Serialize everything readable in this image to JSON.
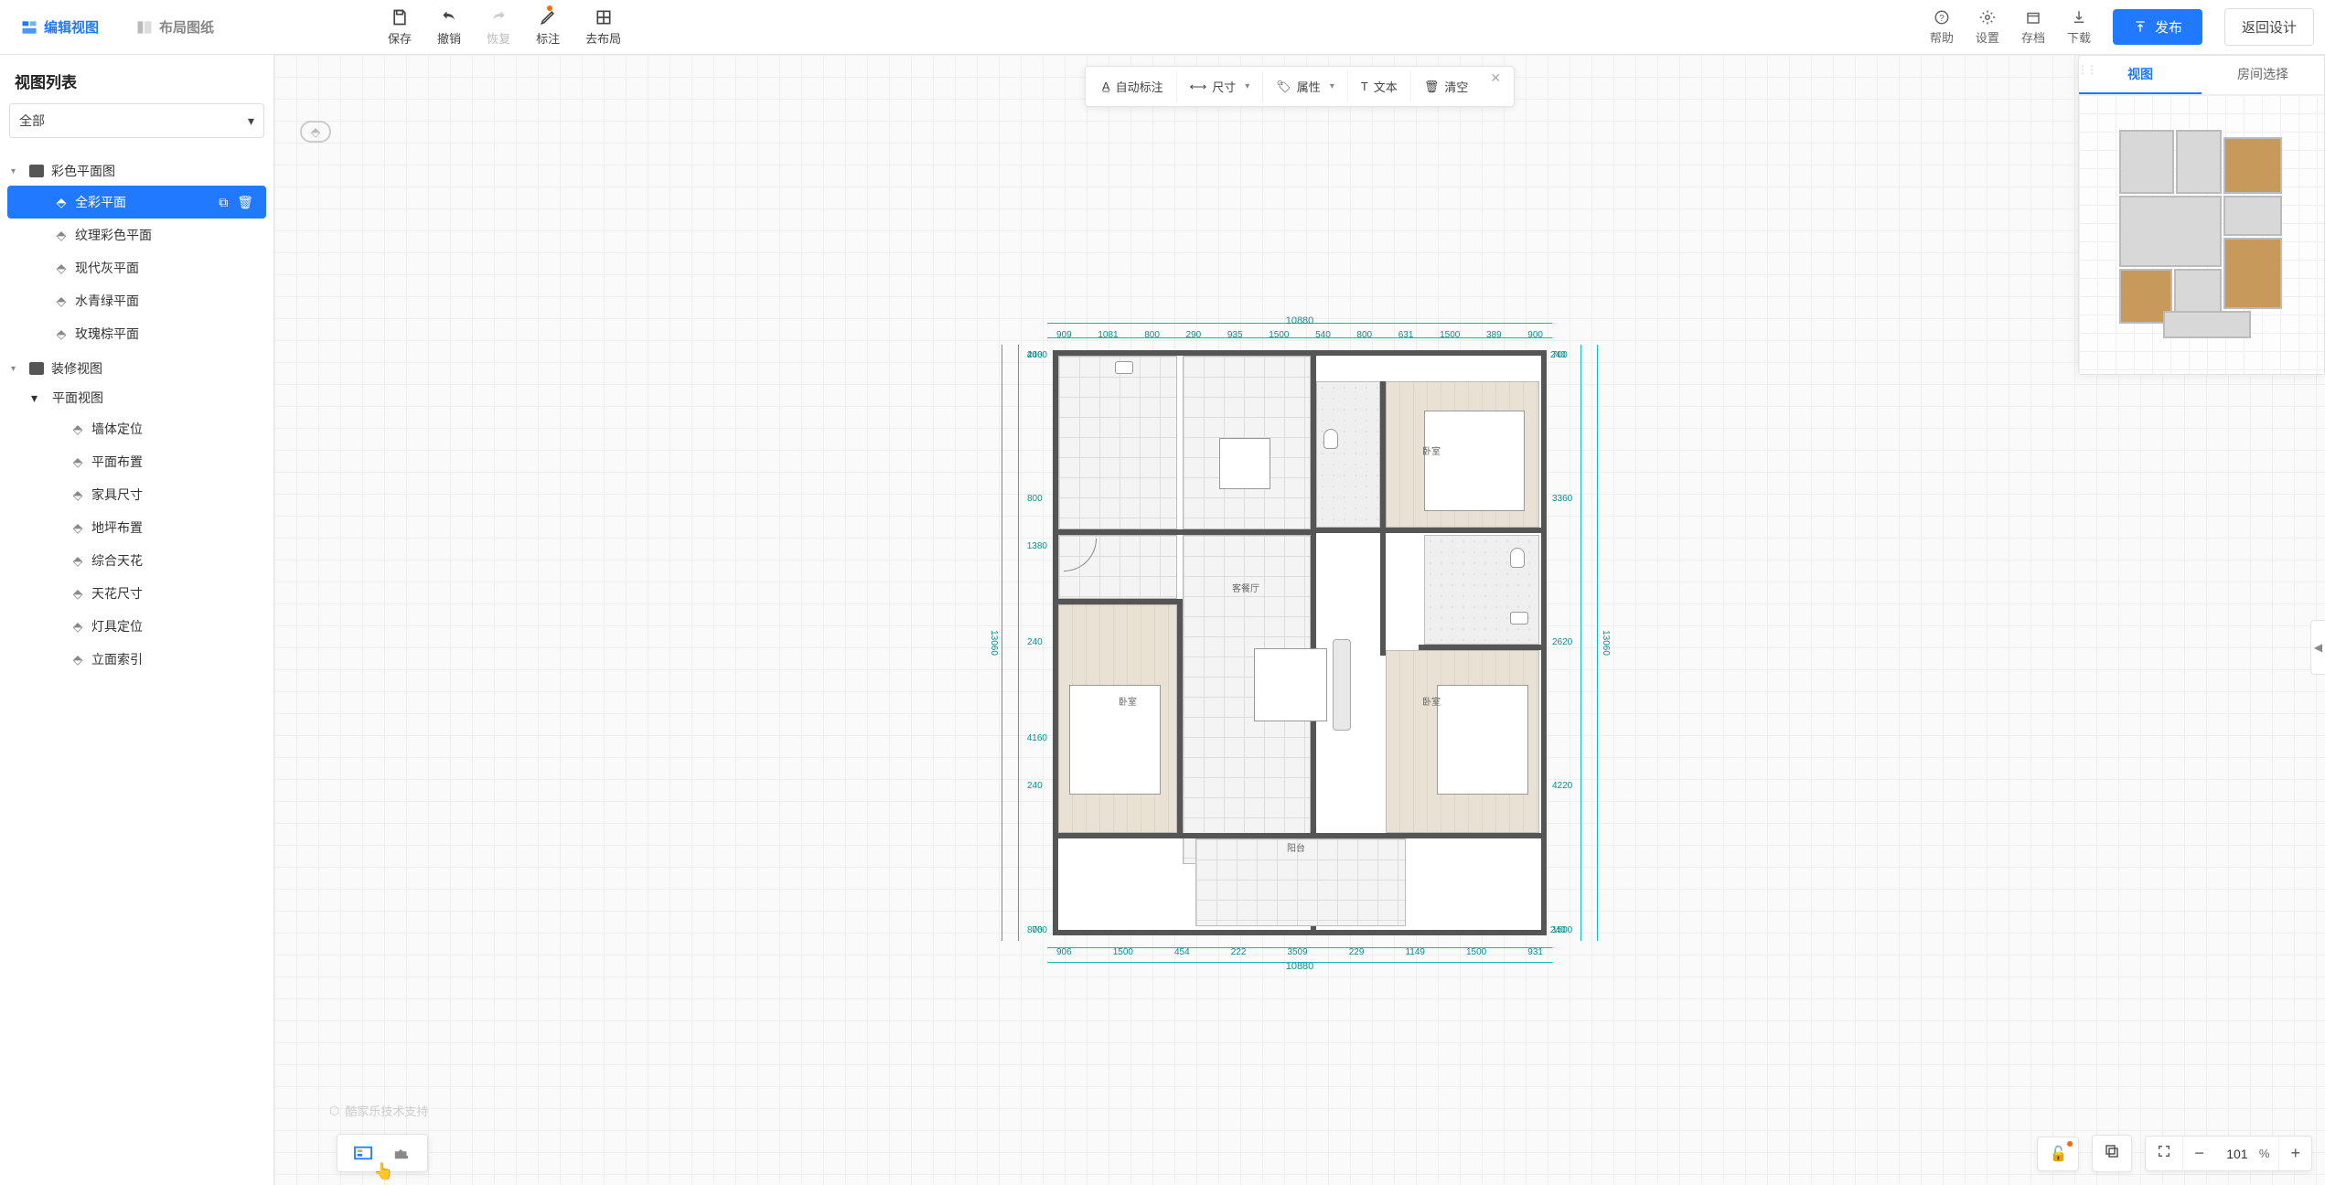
{
  "header": {
    "left_tabs": [
      {
        "label": "编辑视图",
        "active": true
      },
      {
        "label": "布局图纸",
        "active": false
      }
    ],
    "center": {
      "save": "保存",
      "undo": "撤销",
      "redo": "恢复",
      "annotate": "标注",
      "layout": "去布局"
    },
    "right": {
      "help": "帮助",
      "settings": "设置",
      "archive": "存档",
      "download": "下载",
      "publish": "发布",
      "back": "返回设计"
    }
  },
  "sidebar": {
    "title": "视图列表",
    "filter": "全部",
    "groups": [
      {
        "label": "彩色平面图",
        "items": [
          {
            "label": "全彩平面",
            "active": true
          },
          {
            "label": "纹理彩色平面"
          },
          {
            "label": "现代灰平面"
          },
          {
            "label": "水青绿平面"
          },
          {
            "label": "玫瑰棕平面"
          }
        ]
      },
      {
        "label": "装修视图",
        "subgroups": [
          {
            "label": "平面视图",
            "items": [
              {
                "label": "墙体定位"
              },
              {
                "label": "平面布置"
              },
              {
                "label": "家具尺寸"
              },
              {
                "label": "地坪布置"
              },
              {
                "label": "综合天花"
              },
              {
                "label": "天花尺寸"
              },
              {
                "label": "灯具定位"
              },
              {
                "label": "立面索引"
              }
            ]
          }
        ]
      }
    ]
  },
  "anno_toolbar": {
    "auto": "自动标注",
    "dim": "尺寸",
    "attr": "属性",
    "text": "文本",
    "clear": "清空"
  },
  "plan": {
    "total_width": "10880",
    "total_height": "13060",
    "top_dims": [
      "909",
      "1081",
      "800",
      "290",
      "935",
      "1500",
      "540",
      "800",
      "631",
      "1500",
      "389",
      "900"
    ],
    "bottom_dims": [
      "906",
      "1500",
      "454",
      "222",
      "3509",
      "229",
      "1149",
      "1500",
      "931"
    ],
    "left_dims_outer": [
      "4060",
      "1380",
      "4160",
      "760"
    ],
    "left_dims_inner": [
      "240",
      "800",
      "240",
      "240",
      "800"
    ],
    "right_dims_outer": [
      "700",
      "3360",
      "2620",
      "4220",
      "1500"
    ],
    "right_dims_inner": [
      "240",
      "240"
    ],
    "room_labels": {
      "living": "客餐厅",
      "bedroom1": "卧室",
      "bedroom2": "卧室",
      "bedroom3": "卧室",
      "balcony": "阳台"
    }
  },
  "watermark": "酷家乐技术支持",
  "right_panel": {
    "tab_view": "视图",
    "tab_room": "房间选择"
  },
  "zoom": {
    "value": "101",
    "unit": "%"
  }
}
